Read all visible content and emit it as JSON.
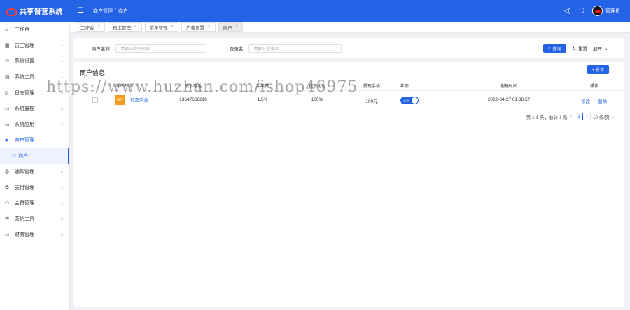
{
  "app": {
    "title": "共享晋营系统"
  },
  "header": {
    "breadcrumb": [
      "商户管理",
      "/",
      "商户"
    ],
    "icons": [
      "sound-icon",
      "fullscreen-icon"
    ],
    "user": {
      "name": "管理员"
    }
  },
  "sidebar": {
    "items": [
      {
        "label": "工作台",
        "icon": "⌂",
        "arrow": ""
      },
      {
        "label": "员工管理",
        "icon": "▦",
        "arrow": "⌄"
      },
      {
        "label": "系统设置",
        "icon": "⚙",
        "arrow": "⌄"
      },
      {
        "label": "系统工具",
        "icon": "▤",
        "arrow": "⌄"
      },
      {
        "label": "日志管理",
        "icon": "▯",
        "arrow": "⌄"
      },
      {
        "label": "系统监控",
        "icon": "▭",
        "arrow": "⌄"
      },
      {
        "label": "系统应用",
        "icon": "▭",
        "arrow": "⌄"
      },
      {
        "label": "商户管理",
        "icon": "◈",
        "arrow": "⌃"
      }
    ],
    "sub_active": {
      "label": "商户",
      "icon": "⚇"
    },
    "items_after": [
      {
        "label": "通知管理",
        "icon": "◍",
        "arrow": "⌄"
      },
      {
        "label": "支付管理",
        "icon": "✿",
        "arrow": "⌄"
      },
      {
        "label": "会员管理",
        "icon": "⚇",
        "arrow": "⌄"
      },
      {
        "label": "营销工具",
        "icon": "☰",
        "arrow": "⌄"
      },
      {
        "label": "财务管理",
        "icon": "▭",
        "arrow": "⌄"
      }
    ]
  },
  "tabs": [
    {
      "label": "工作台",
      "active": false
    },
    {
      "label": "员工管理",
      "active": false
    },
    {
      "label": "菜单管理",
      "active": false
    },
    {
      "label": "广告设置",
      "active": false
    },
    {
      "label": "商户",
      "active": true
    }
  ],
  "filter": {
    "merchant_name_label": "商户名称:",
    "merchant_name_placeholder": "请输入商户名称",
    "account_label": "登录名:",
    "account_placeholder": "请输入登录名",
    "search_label": "查询",
    "reset_label": "重置",
    "expand_label": "展开"
  },
  "table": {
    "title": "商户信息",
    "add_label": "+ 新增",
    "columns": [
      "商户名称",
      "联系电话",
      "手续费",
      "提现比例",
      "提现手续",
      "状态",
      "创建时间",
      "操作"
    ],
    "rows": [
      {
        "thumb_text": "商户",
        "name": "有正商业",
        "phone": "13647666210",
        "fee": "1.5%",
        "ratio": "100%",
        "amount": "100元",
        "status_label": "正常",
        "created": "2022-04-27 01:38:57",
        "edit_label": "修改",
        "delete_label": "删除"
      }
    ]
  },
  "pagination": {
    "summary": "第 1-1 条，总计 1 条",
    "current_page": "1",
    "page_size": "10 条/页"
  },
  "watermark": "https://www.huzhan.com/ishop46975",
  "colors": {
    "primary": "#2563e6",
    "thumb": "#f59b1b"
  }
}
